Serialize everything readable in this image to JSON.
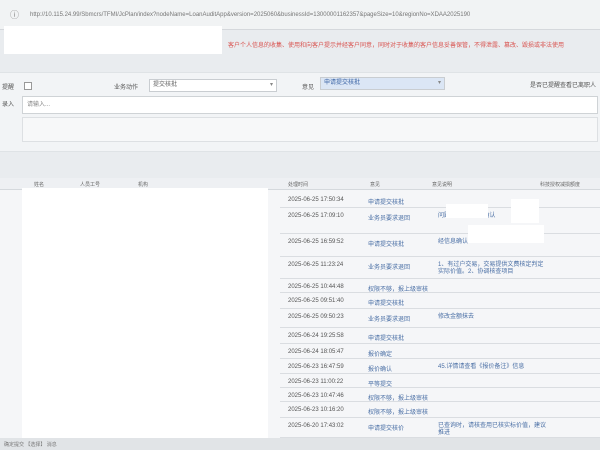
{
  "browser": {
    "url": "http://10.115.24.99/Sbmcrs/TFMI/JcPlan/index?nodeName=LoanAuditApp&version=2025060&businessId=13000001162357&pageSize=10&regionNo=XDAA2025190"
  },
  "notice": {
    "text": "客户个人信息的收集、使用和向客户提示并经客户同意，同时对于收集的客户信息妥善保管，不得泄露、篡改、毁损或非法使用"
  },
  "form": {
    "checkbox_label": "提醒",
    "action_label": "业务动作",
    "action_value": "提交核批",
    "opinion_label": "意见",
    "opinion_value": "申请提交核批",
    "right_note": "是否已提醒查看已离职人",
    "input_label": "录入",
    "input_placeholder": "请输入..."
  },
  "table": {
    "headers": {
      "c1": "姓名",
      "c2": "人员工号",
      "c3": "机构",
      "c4": "处理时间",
      "c5": "意见",
      "c6": "意见说明",
      "c7": "科技授权减损额度"
    },
    "rows": [
      {
        "time": "2025-06-25 17:50:34",
        "op": "申请提交核批",
        "desc": ""
      },
      {
        "time": "2025-06-25 17:09:10",
        "op": "业务员要求退回",
        "desc": "问题         传值线         台报确认"
      },
      {
        "time": "2025-06-25 16:59:52",
        "op": "申请提交核批",
        "desc": "经信息确认"
      },
      {
        "time": "2025-06-25 11:23:24",
        "op": "业务员要求退回",
        "desc": "1、有过户交易，交易提供文费核定判定实际价值。2、协调核查项目"
      },
      {
        "time": "2025-06-25 10:44:48",
        "op": "权限不够，报上级审核",
        "desc": ""
      },
      {
        "time": "2025-06-25 09:51:40",
        "op": "申请提交核批",
        "desc": ""
      },
      {
        "time": "2025-06-25 09:50:23",
        "op": "业务员要求退回",
        "desc": "修改金额抹去"
      },
      {
        "time": "2025-06-24 19:25:58",
        "op": "申请提交核批",
        "desc": ""
      },
      {
        "time": "2025-06-24 18:05:47",
        "op": "报价确定",
        "desc": ""
      },
      {
        "time": "2025-06-23 16:47:59",
        "op": "报价确认",
        "desc": "45.详情请查看《报价备注》信息"
      },
      {
        "time": "2025-06-23 11:00:22",
        "op": "平等提交",
        "desc": ""
      },
      {
        "time": "2025-06-23 10:47:46",
        "op": "权限不够，报上级审核",
        "desc": ""
      },
      {
        "time": "2025-06-23 10:16:20",
        "op": "权限不够，报上级审核",
        "desc": ""
      },
      {
        "time": "2025-06-20 17:43:02",
        "op": "申请提交核价",
        "desc": "已查询时，请核查用已核实标价值，建议推进"
      }
    ]
  },
  "footer": {
    "text": "确定提交 【选择】 消息"
  }
}
